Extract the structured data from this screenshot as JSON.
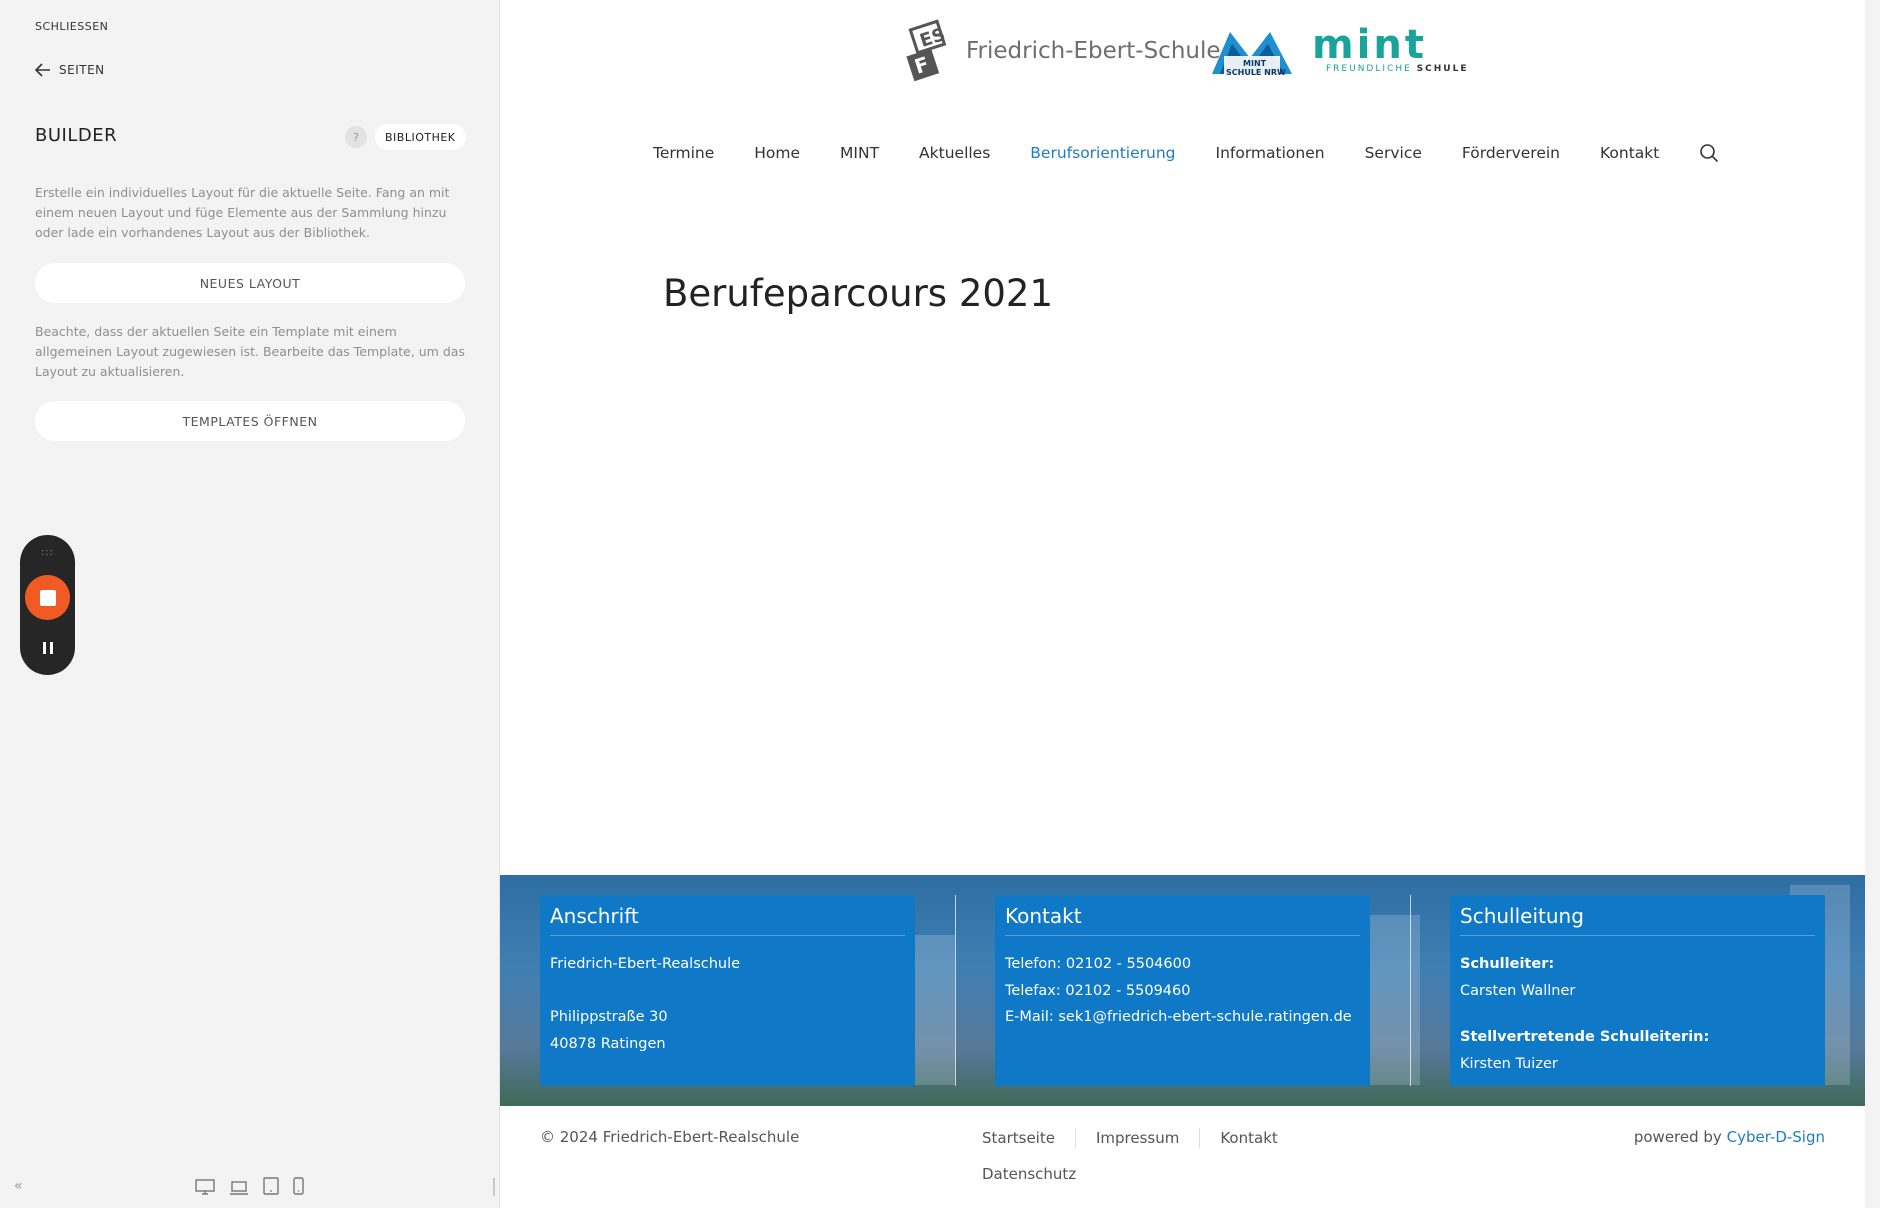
{
  "sidebar": {
    "close_label": "SCHLIESSEN",
    "back_label": "SEITEN",
    "title": "BUILDER",
    "help_label": "?",
    "library_label": "BIBLIOTHEK",
    "intro_text": "Erstelle ein individuelles Layout für die aktuelle Seite. Fang an mit einem neuen Layout und füge Elemente aus der Sammlung hinzu oder lade ein vorhandenes Layout aus der Bibliothek.",
    "new_layout_label": "NEUES LAYOUT",
    "template_text": "Beachte, dass der aktuellen Seite ein Template mit einem allgemeinen Layout zugewiesen ist. Bearbeite das Template, um das Layout zu aktualisieren.",
    "open_templates_label": "TEMPLATES ÖFFNEN",
    "collapse_label": "«",
    "recorder_grip": ":::"
  },
  "header": {
    "school_name": "Friedrich-Ebert-Schule",
    "mint_nrw_line1": "MINT",
    "mint_nrw_line2": "SCHULE NRW",
    "mint_word": "mint",
    "mint_small_1": "FREUNDLICHE",
    "mint_small_2": "SCHULE"
  },
  "nav": {
    "items": [
      {
        "label": "Termine"
      },
      {
        "label": "Home"
      },
      {
        "label": "MINT"
      },
      {
        "label": "Aktuelles"
      },
      {
        "label": "Berufsorientierung"
      },
      {
        "label": "Informationen"
      },
      {
        "label": "Service"
      },
      {
        "label": "Förderverein"
      },
      {
        "label": "Kontakt"
      }
    ],
    "active": "Berufsorientierung"
  },
  "main": {
    "title": "Berufeparcours 2021"
  },
  "footer": {
    "address": {
      "heading": "Anschrift",
      "name": "Friedrich-Ebert-Realschule",
      "street": "Philippstraße 30",
      "city": "40878 Ratingen"
    },
    "contact": {
      "heading": "Kontakt",
      "phone": "Telefon: 02102 - 5504600",
      "fax": "Telefax: 02102 - 5509460",
      "email": "E-Mail: sek1@friedrich-ebert-schule.ratingen.de"
    },
    "leadership": {
      "heading": "Schulleitung",
      "head_label": "Schulleiter:",
      "head_name": "Carsten Wallner",
      "deputy_label": "Stellvertretende Schulleiterin:",
      "deputy_name": "Kirsten Tuizer"
    }
  },
  "bottom": {
    "copyright": "© 2024 Friedrich-Ebert-Realschule",
    "links": [
      "Startseite",
      "Impressum",
      "Kontakt",
      "Datenschutz"
    ],
    "powered_prefix": "powered by",
    "powered_link": "Cyber-D-Sign"
  },
  "colors": {
    "accent": "#1f7cc4",
    "footer_panel": "#0f79c7",
    "mint": "#1aa39a",
    "record": "#f15a24"
  }
}
